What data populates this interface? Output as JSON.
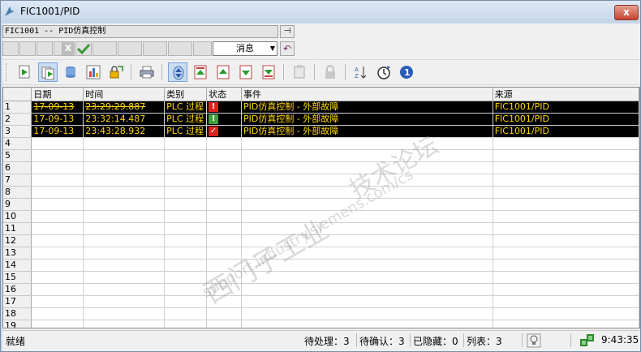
{
  "window": {
    "title": "FIC1001/PID",
    "close_label": "x"
  },
  "header": {
    "caption": "FIC1001 -- PID仿真控制",
    "pin_label": "⊣",
    "filter_x_label": "X",
    "message_type": "消息"
  },
  "grid": {
    "columns": [
      "日期",
      "时间",
      "类别",
      "状态",
      "事件",
      "来源"
    ],
    "rows": [
      {
        "num": "1",
        "date": "17-09-13",
        "time": "23:29:29.887",
        "category": "PLC 过程",
        "status": "!",
        "status_color": "#e02020",
        "event": "PID仿真控制 - 外部故障",
        "source": "FIC1001/PID"
      },
      {
        "num": "2",
        "date": "17-09-13",
        "time": "23:32:14.487",
        "category": "PLC 过程",
        "status": "!",
        "status_color": "#40a040",
        "event": "PID仿真控制 - 外部故障",
        "source": "FIC1001/PID"
      },
      {
        "num": "3",
        "date": "17-09-13",
        "time": "23:43:28.932",
        "category": "PLC 过程",
        "status": "✓",
        "status_color": "#e02020",
        "event": "PID仿真控制 - 外部故障",
        "source": "FIC1001/PID"
      }
    ],
    "empty_rows": [
      "4",
      "5",
      "6",
      "7",
      "8",
      "9",
      "10",
      "11",
      "12",
      "13",
      "14",
      "15",
      "16",
      "17",
      "18",
      "19"
    ]
  },
  "statusbar": {
    "ready": "就绪",
    "pending": "待处理：3",
    "to_ack": "待确认：3",
    "hidden": "已隐藏：0",
    "list": "列表：3",
    "time": "9:43:35"
  },
  "watermark": {
    "line1": "西门子工业",
    "line2": "support.industry.siemens.com/cs",
    "line3": "技术论坛"
  }
}
